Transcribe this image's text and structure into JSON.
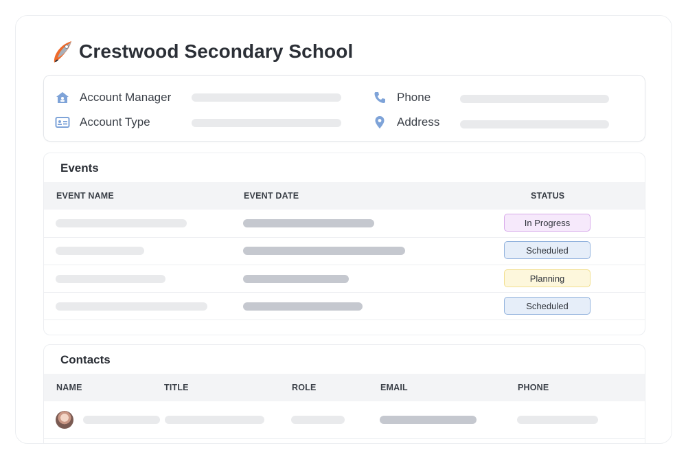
{
  "school": {
    "title": "Crestwood Secondary School"
  },
  "info": {
    "account_manager_label": "Account Manager",
    "account_type_label": "Account Type",
    "phone_label": "Phone",
    "address_label": "Address",
    "icons": [
      "home-icon",
      "id-card-icon",
      "phone-icon",
      "location-pin-icon"
    ]
  },
  "events": {
    "title": "Events",
    "columns": [
      "EVENT NAME",
      "EVENT DATE",
      "STATUS"
    ],
    "rows": [
      {
        "status": "In Progress"
      },
      {
        "status": "Scheduled"
      },
      {
        "status": "Planning"
      },
      {
        "status": "Scheduled"
      }
    ]
  },
  "contacts": {
    "title": "Contacts",
    "columns": [
      "NAME",
      "TITLE",
      "ROLE",
      "EMAIL",
      "PHONE"
    ]
  },
  "colors": {
    "accent": "#7ea3d8",
    "in_progress_bg": "#f6e9fb",
    "in_progress_border": "#d7a8ea",
    "scheduled_bg": "#e6eef9",
    "scheduled_border": "#8fb0dc",
    "planning_bg": "#fdf7dc",
    "planning_border": "#f1de8c"
  }
}
